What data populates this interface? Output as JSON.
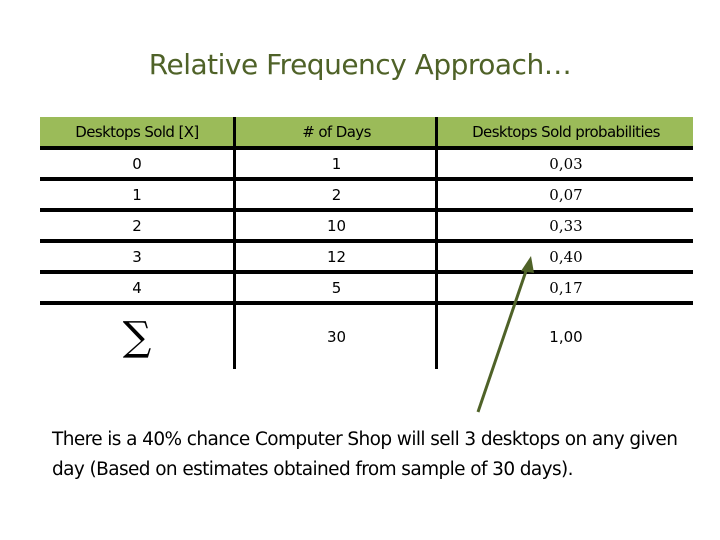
{
  "title": "Relative Frequency Approach…",
  "table": {
    "headers": [
      "Desktops Sold [X]",
      "# of Days",
      "Desktops Sold probabilities"
    ],
    "rows": [
      [
        "0",
        "1",
        "0,03"
      ],
      [
        "1",
        "2",
        "0,07"
      ],
      [
        "2",
        "10",
        "0,33"
      ],
      [
        "3",
        "12",
        "0,40"
      ],
      [
        "4",
        "5",
        "0,17"
      ]
    ],
    "total": {
      "symbol": "∑",
      "days": "30",
      "probability": "1,00"
    }
  },
  "annotation": {
    "points_to_row": 3,
    "points_to_value": "0,40"
  },
  "note": "There is a 40% chance Computer Shop will sell 3 desktops on any given day (Based on estimates obtained from sample of 30 days).",
  "colors": {
    "title": "#4f6228",
    "header_bg": "#9bbb59",
    "arrow": "#4f6228"
  }
}
